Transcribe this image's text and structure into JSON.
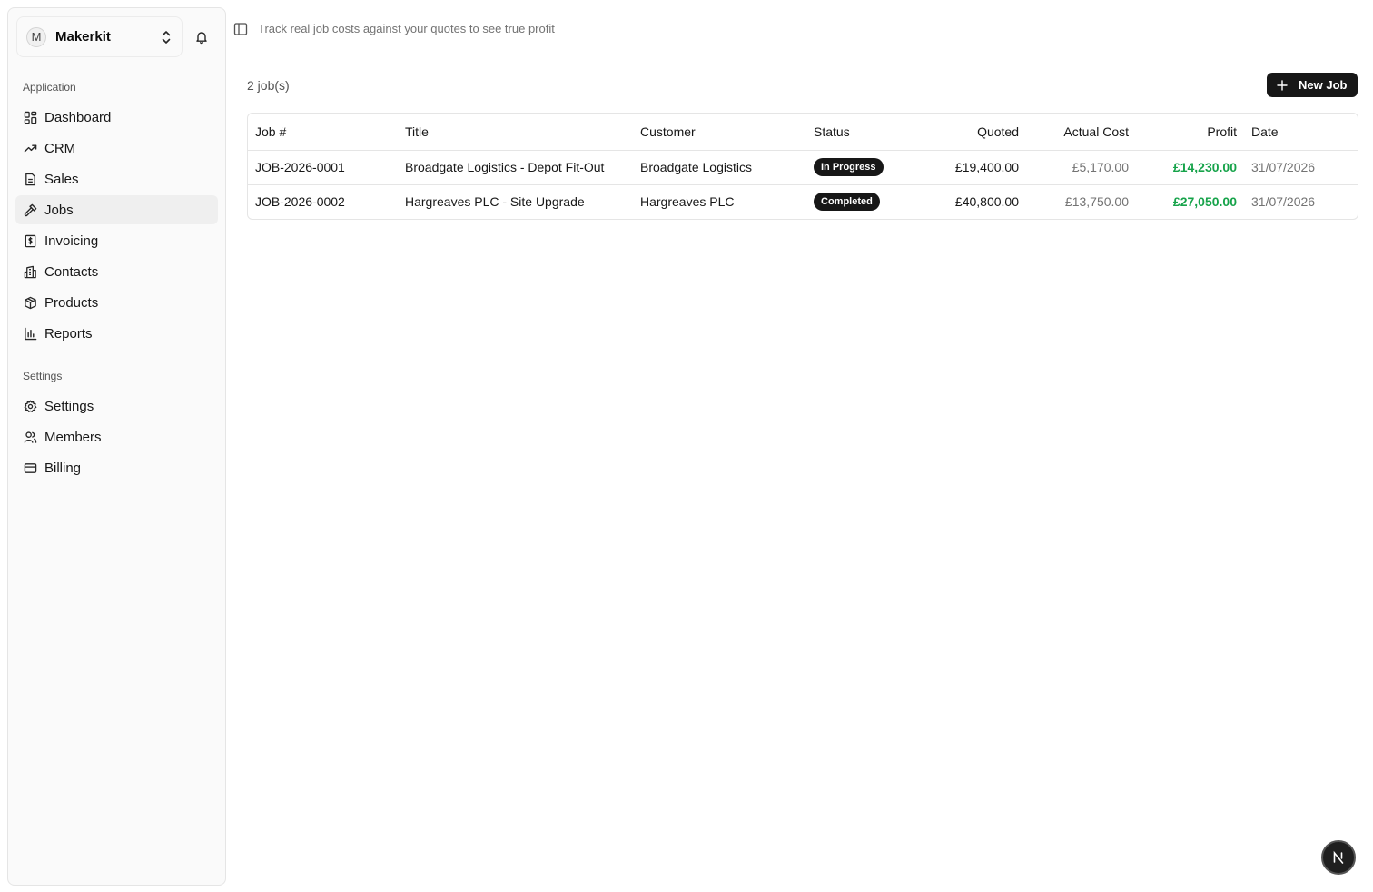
{
  "team": {
    "initial": "M",
    "name": "Makerkit"
  },
  "sidebar": {
    "groups": [
      {
        "label": "Application",
        "items": [
          {
            "label": "Dashboard",
            "icon": "dashboard-icon"
          },
          {
            "label": "CRM",
            "icon": "trending-icon"
          },
          {
            "label": "Sales",
            "icon": "document-icon"
          },
          {
            "label": "Jobs",
            "icon": "hammer-icon",
            "active": true
          },
          {
            "label": "Invoicing",
            "icon": "receipt-icon"
          },
          {
            "label": "Contacts",
            "icon": "building-icon"
          },
          {
            "label": "Products",
            "icon": "package-icon"
          },
          {
            "label": "Reports",
            "icon": "bar-chart-icon"
          }
        ]
      },
      {
        "label": "Settings",
        "items": [
          {
            "label": "Settings",
            "icon": "gear-icon"
          },
          {
            "label": "Members",
            "icon": "users-icon"
          },
          {
            "label": "Billing",
            "icon": "credit-card-icon"
          }
        ]
      }
    ]
  },
  "header": {
    "description": "Track real job costs against your quotes to see true profit"
  },
  "jobs": {
    "count_label": "2 job(s)",
    "new_button_label": "New Job",
    "columns": {
      "job_no": "Job #",
      "title": "Title",
      "customer": "Customer",
      "status": "Status",
      "quoted": "Quoted",
      "actual_cost": "Actual Cost",
      "profit": "Profit",
      "date": "Date"
    },
    "rows": [
      {
        "job_no": "JOB-2026-0001",
        "title": "Broadgate Logistics - Depot Fit-Out",
        "customer": "Broadgate Logistics",
        "status": "In Progress",
        "quoted": "£19,400.00",
        "actual_cost": "£5,170.00",
        "profit": "£14,230.00",
        "date": "31/07/2026"
      },
      {
        "job_no": "JOB-2026-0002",
        "title": "Hargreaves PLC - Site Upgrade",
        "customer": "Hargreaves PLC",
        "status": "Completed",
        "quoted": "£40,800.00",
        "actual_cost": "£13,750.00",
        "profit": "£27,050.00",
        "date": "31/07/2026"
      }
    ]
  },
  "colors": {
    "profit": "#16a34a",
    "primary": "#171717",
    "active_nav": "#efefef"
  },
  "fab": {
    "letter": "N"
  }
}
